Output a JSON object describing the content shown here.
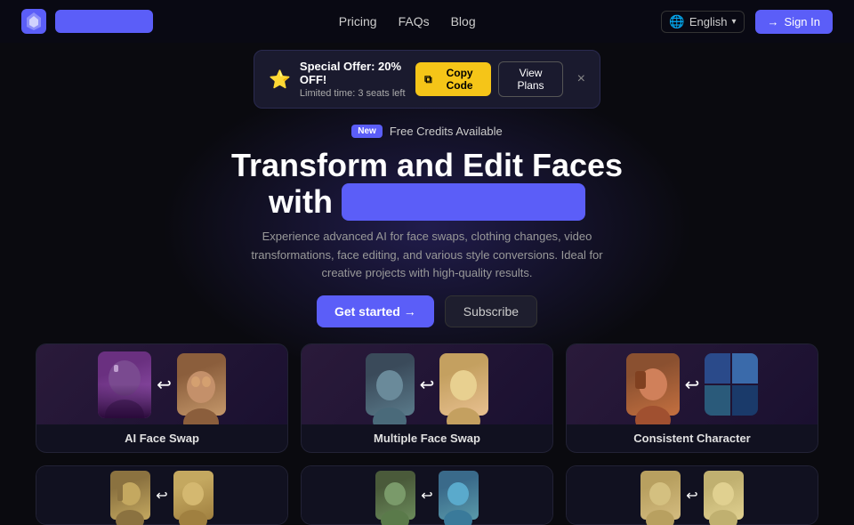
{
  "brand": {
    "logo_label": "App Logo"
  },
  "navbar": {
    "links": [
      {
        "label": "Pricing",
        "id": "pricing"
      },
      {
        "label": "FAQs",
        "id": "faqs"
      },
      {
        "label": "Blog",
        "id": "blog"
      }
    ],
    "language": "English",
    "sign_in": "Sign In"
  },
  "banner": {
    "star": "⭐",
    "title": "Special Offer: 20% OFF!",
    "subtitle": "Limited time: 3 seats left",
    "copy_label": "Copy Code",
    "view_plans_label": "View Plans"
  },
  "hero": {
    "badge": "New",
    "free_credits": "Free Credits Available",
    "title_line1": "Transform and Edit Faces",
    "title_line2_prefix": "with",
    "title_highlight": "",
    "subtitle": "Experience advanced AI for face swaps, clothing changes, video transformations, face editing, and various style conversions. Ideal for creative projects with high-quality results.",
    "get_started": "Get started →",
    "subscribe": "Subscribe"
  },
  "cards": {
    "row1": [
      {
        "label": "AI Face Swap",
        "id": "ai-face-swap"
      },
      {
        "label": "Multiple Face Swap",
        "id": "multiple-face-swap"
      },
      {
        "label": "Consistent Character",
        "id": "consistent-character"
      }
    ],
    "row2": [
      {
        "label": "",
        "id": "card-4"
      },
      {
        "label": "",
        "id": "card-5"
      },
      {
        "label": "",
        "id": "card-6"
      }
    ]
  },
  "icons": {
    "globe": "🌐",
    "chevron_down": "▾",
    "arrow_right": "→",
    "copy": "⧉",
    "sign_in": "→",
    "close": "×",
    "swap_arrow": "↩"
  }
}
